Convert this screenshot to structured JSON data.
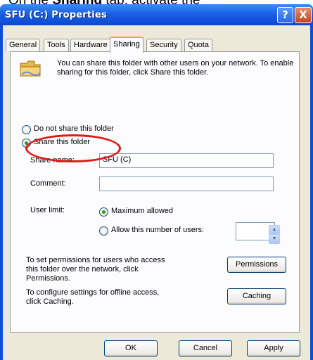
{
  "caption": {
    "prefix": "On the ",
    "bold": "Sharing",
    "suffix": " tab, activate the"
  },
  "window": {
    "title": "SFU (C:) Properties",
    "help_label": "?",
    "close_label": "X"
  },
  "tabs": [
    {
      "label": "General"
    },
    {
      "label": "Tools"
    },
    {
      "label": "Hardware"
    },
    {
      "label": "Sharing",
      "active": true
    },
    {
      "label": "Security"
    },
    {
      "label": "Quota"
    }
  ],
  "sharing": {
    "info_text": "You can share this folder with other users on your network. To enable sharing for this folder, click Share this folder.",
    "do_not_share_label": "Do not share this folder",
    "share_label": "Share this folder",
    "selected_option": "share",
    "share_name_label": "Share name:",
    "share_name_value": "SFU (C)",
    "comment_label": "Comment:",
    "comment_value": "",
    "user_limit_label": "User limit:",
    "maximum_allowed_label": "Maximum allowed",
    "allow_number_label": "Allow this number of users:",
    "user_limit_selected": "maximum",
    "user_count_value": "",
    "permissions_text": "To set permissions for users who access this folder over the network, click Permissions.",
    "permissions_button": "Permissions",
    "caching_text": "To configure settings for offline access, click Caching.",
    "caching_button": "Caching"
  },
  "footer": {
    "ok": "OK",
    "cancel": "Cancel",
    "apply": "Apply"
  },
  "colors": {
    "highlight": "#e01a1a",
    "titlebar": "#0a49d0",
    "dialog_bg": "#ece9d8"
  }
}
